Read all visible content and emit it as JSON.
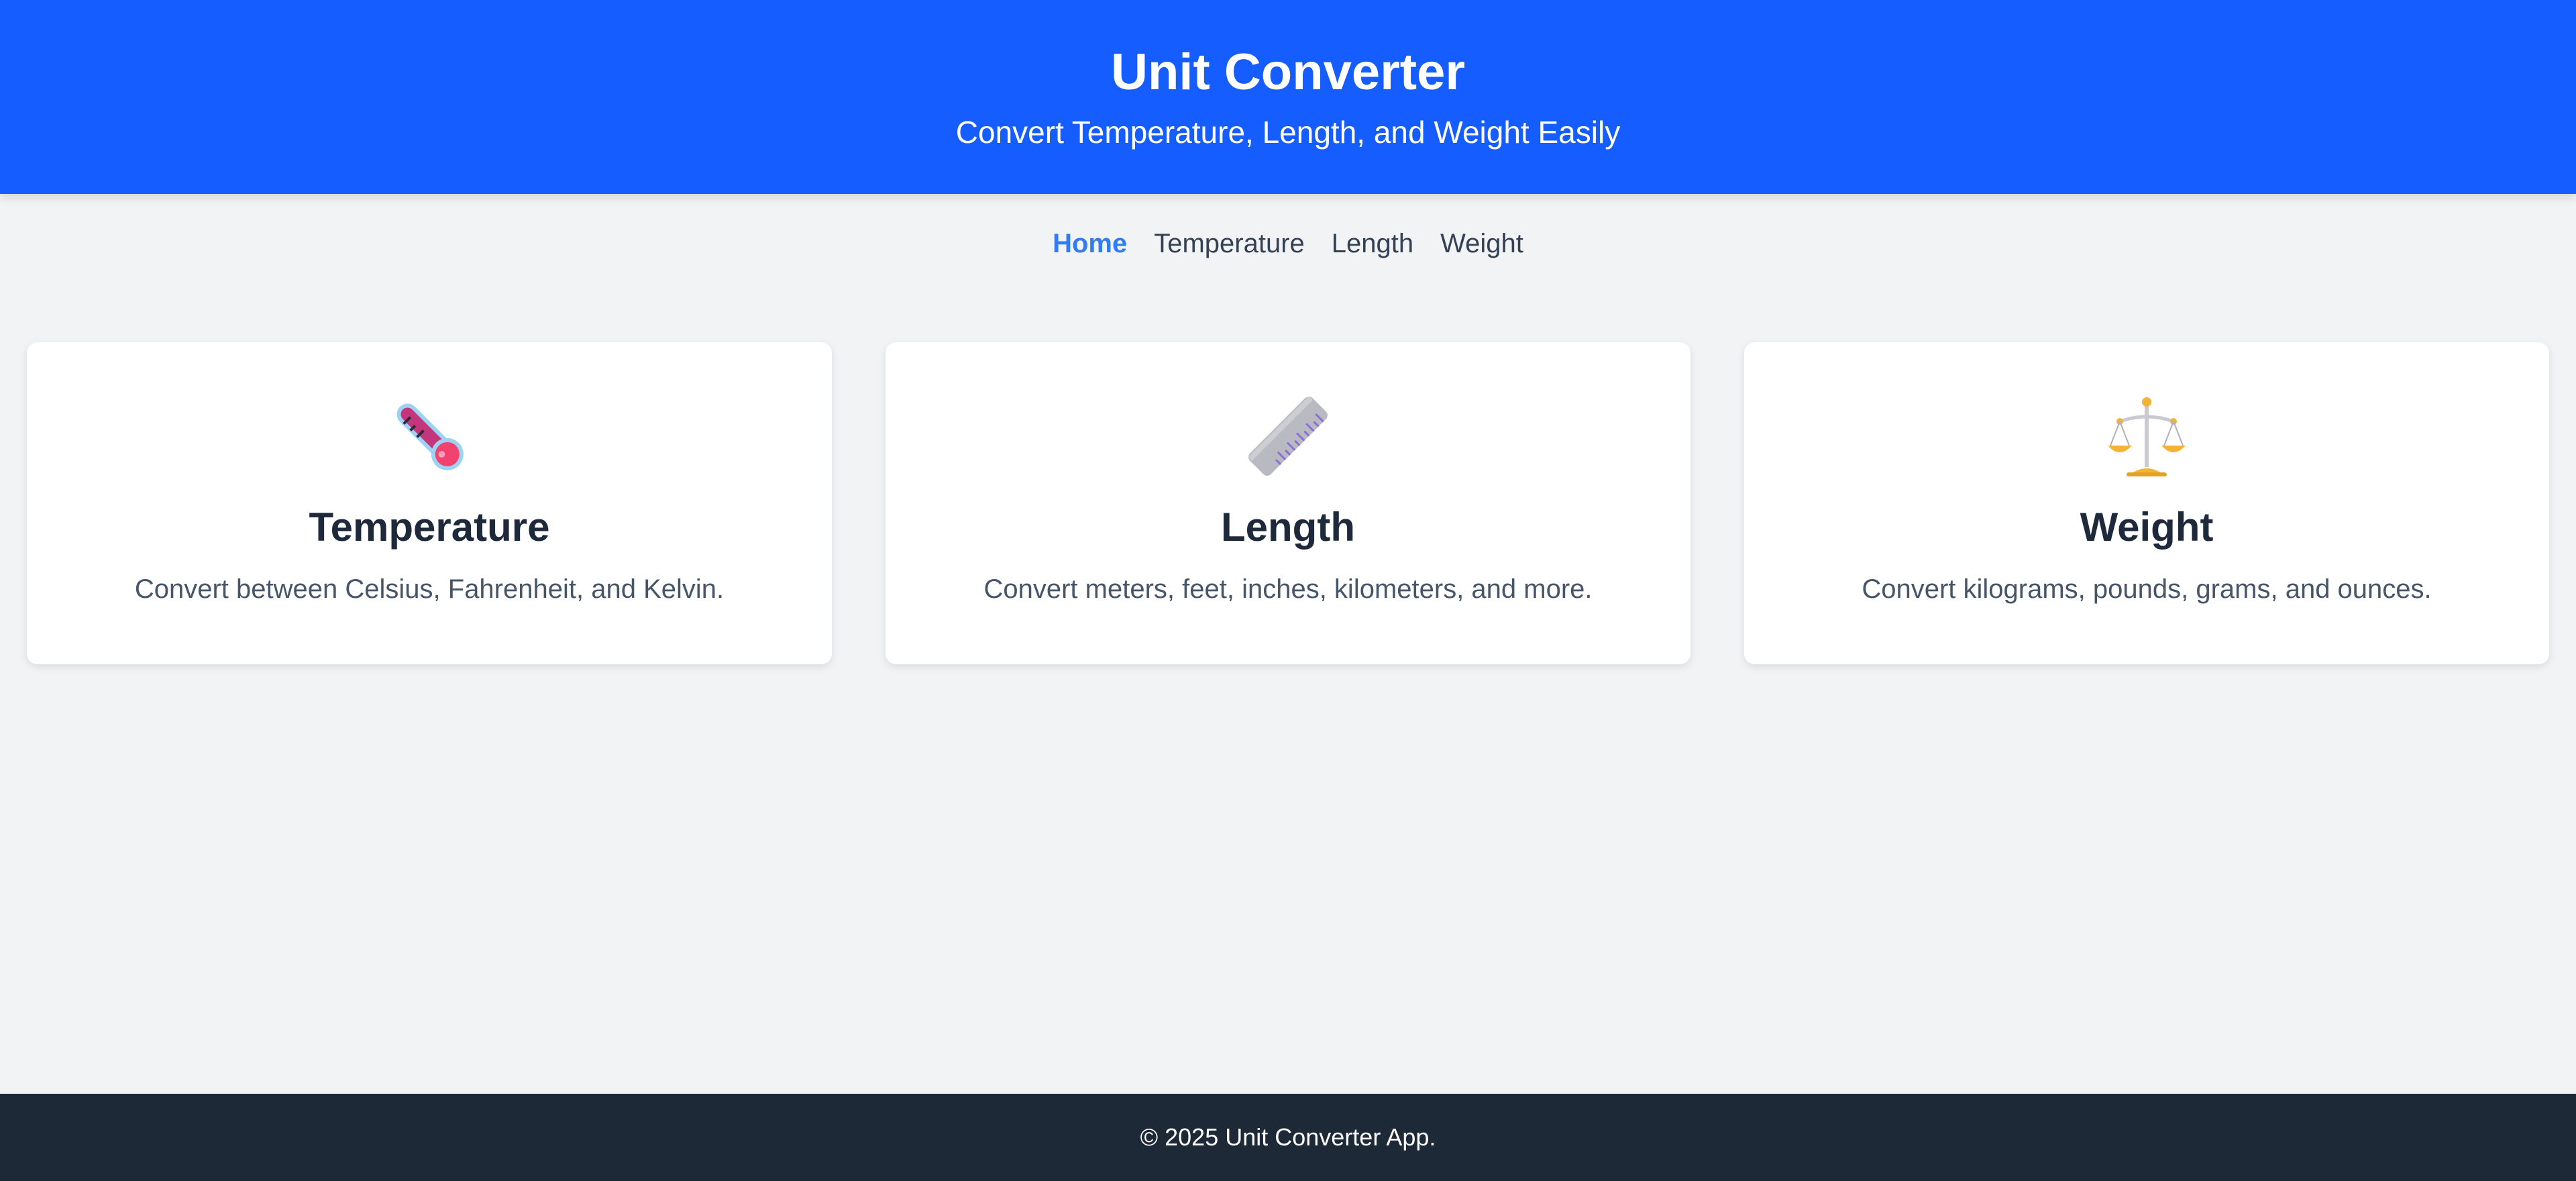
{
  "header": {
    "title": "Unit Converter",
    "subtitle": "Convert Temperature, Length, and Weight Easily"
  },
  "nav": {
    "items": [
      {
        "label": "Home",
        "active": true
      },
      {
        "label": "Temperature",
        "active": false
      },
      {
        "label": "Length",
        "active": false
      },
      {
        "label": "Weight",
        "active": false
      }
    ]
  },
  "cards": [
    {
      "icon": "thermometer-icon",
      "title": "Temperature",
      "description": "Convert between Celsius, Fahrenheit, and Kelvin."
    },
    {
      "icon": "ruler-icon",
      "title": "Length",
      "description": "Convert meters, feet, inches, kilometers, and more."
    },
    {
      "icon": "scales-icon",
      "title": "Weight",
      "description": "Convert kilograms, pounds, grams, and ounces."
    }
  ],
  "footer": {
    "text": "© 2025 Unit Converter App."
  },
  "colors": {
    "header_bg": "#165dff",
    "nav_active": "#2f7cf6",
    "page_bg": "#f2f3f5",
    "footer_bg": "#1e2937"
  }
}
